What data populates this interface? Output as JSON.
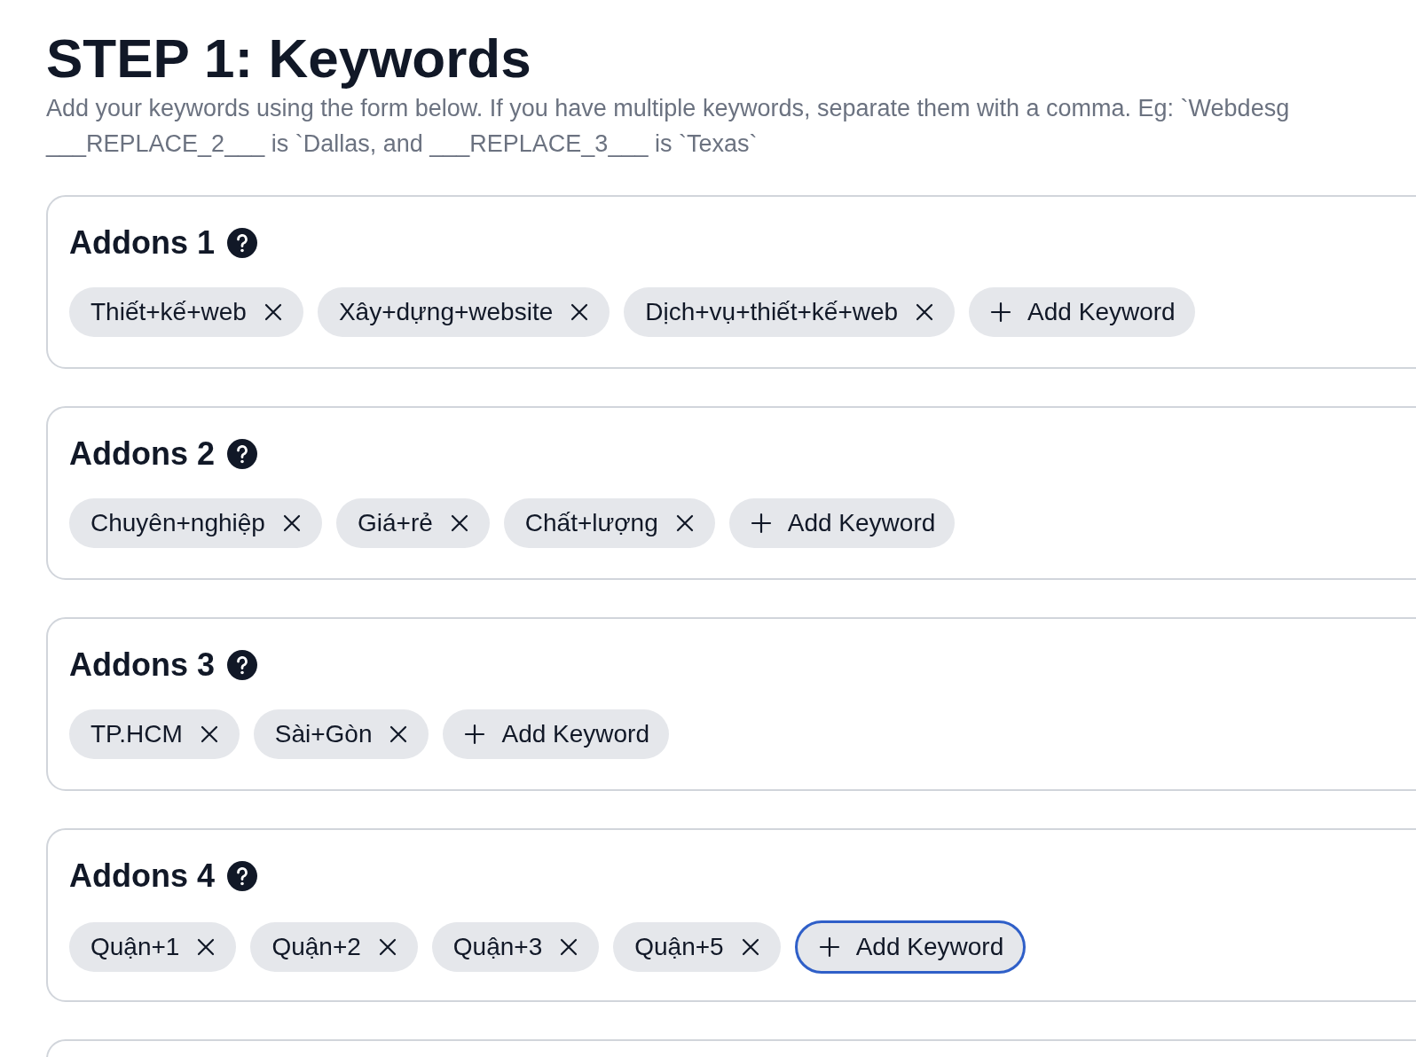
{
  "title": "STEP 1: Keywords",
  "description": [
    "Add your keywords using the form below. If you have multiple keywords, separate them with a comma. Eg: `Webdesg",
    "___REPLACE_2___ is `Dallas, and ___REPLACE_3___ is `Texas`"
  ],
  "groups": [
    {
      "title": "Addons 1",
      "keywords": [
        "Thiết+kế+web",
        "Xây+dựng+website",
        "Dịch+vụ+thiết+kế+web"
      ],
      "add_button": {
        "label": "Add Keyword",
        "focused": false
      }
    },
    {
      "title": "Addons 2",
      "keywords": [
        "Chuyên+nghiệp",
        "Giá+rẻ",
        "Chất+lượng"
      ],
      "add_button": {
        "label": "Add Keyword",
        "focused": false
      }
    },
    {
      "title": "Addons 3",
      "keywords": [
        "TP.HCM",
        "Sài+Gòn"
      ],
      "add_button": {
        "label": "Add Keyword",
        "focused": false
      }
    },
    {
      "title": "Addons 4",
      "keywords": [
        "Quận+1",
        "Quận+2",
        "Quận+3",
        "Quận+5"
      ],
      "add_button": {
        "label": "Add Keyword",
        "focused": true
      }
    }
  ]
}
